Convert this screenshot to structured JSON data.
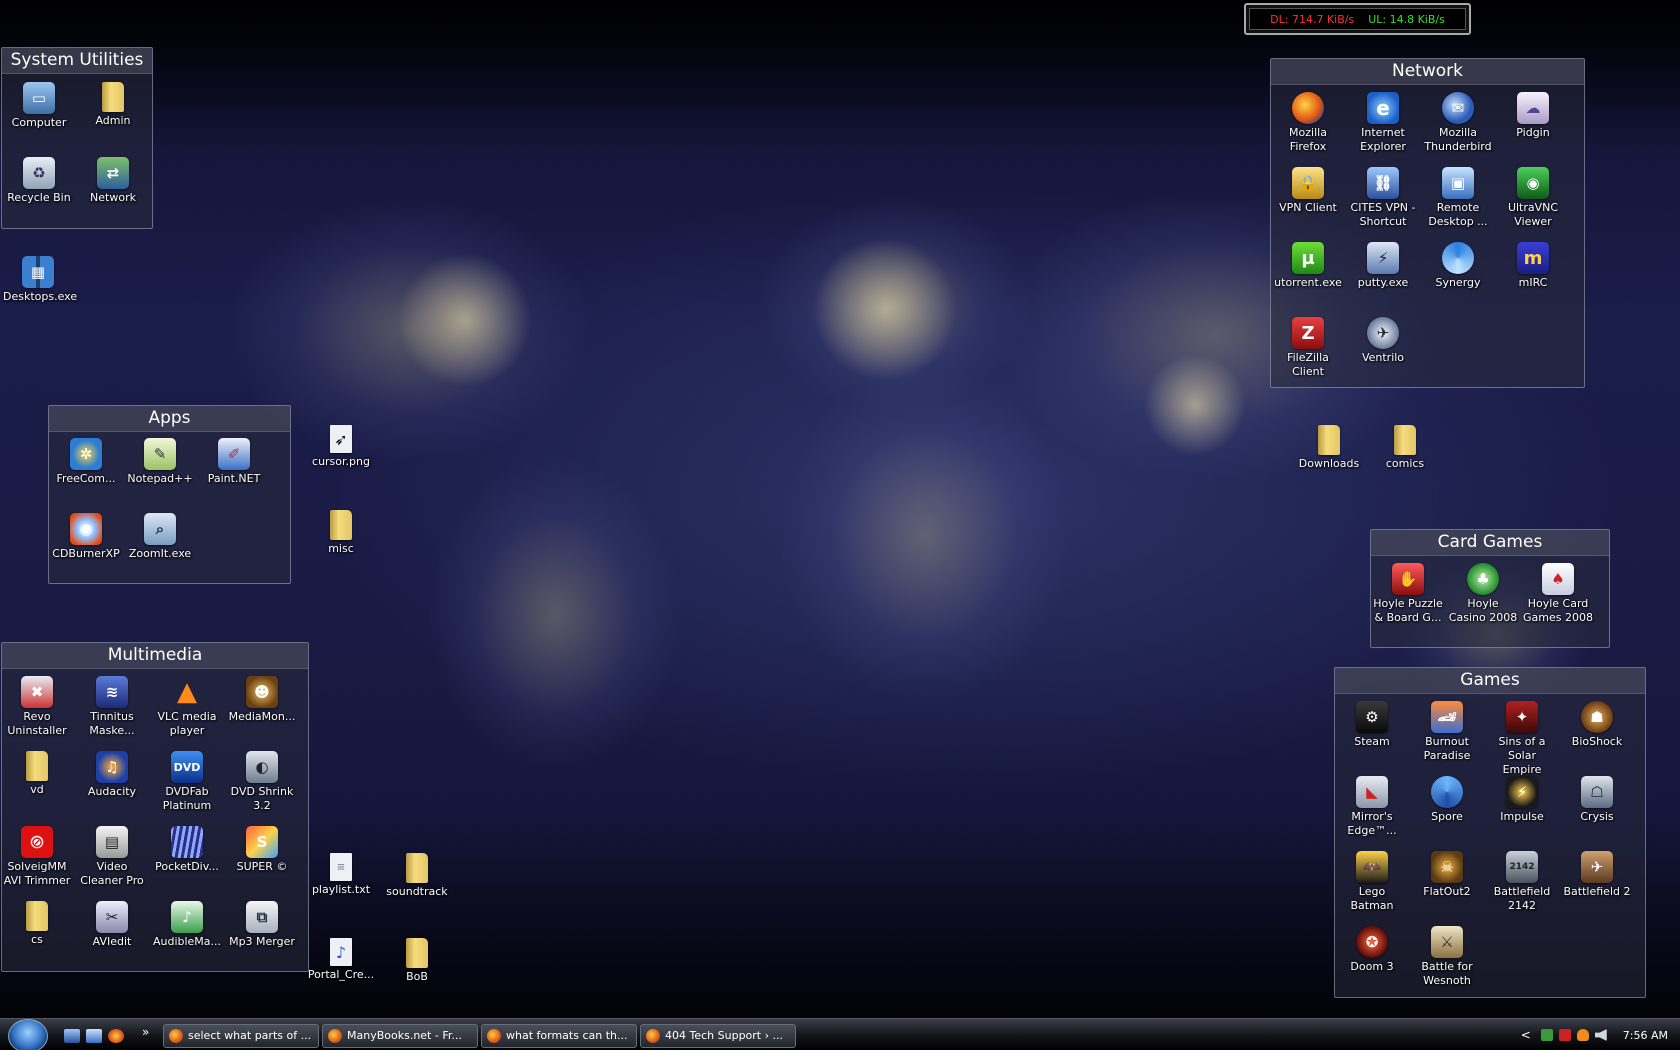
{
  "net_meter": {
    "dl": "DL: 714.7 KiB/s",
    "ul": "UL: 14.8 KiB/s"
  },
  "fences": {
    "system_utilities": {
      "title": "System Utilities",
      "items": [
        "Computer",
        "Admin",
        "Recycle Bin",
        "Network"
      ]
    },
    "network": {
      "title": "Network",
      "items": [
        "Mozilla Firefox",
        "Internet Explorer",
        "Mozilla Thunderbird",
        "Pidgin",
        "VPN Client",
        "CITES VPN - Shortcut",
        "Remote Desktop ...",
        "UltraVNC Viewer",
        "utorrent.exe",
        "putty.exe",
        "Synergy",
        "mIRC",
        "FileZilla Client",
        "Ventrilo"
      ]
    },
    "apps": {
      "title": "Apps",
      "items": [
        "FreeCom...",
        "Notepad++",
        "Paint.NET",
        "CDBurnerXP",
        "ZoomIt.exe"
      ]
    },
    "card_games": {
      "title": "Card Games",
      "items": [
        "Hoyle Puzzle & Board G...",
        "Hoyle Casino 2008",
        "Hoyle Card Games 2008"
      ]
    },
    "multimedia": {
      "title": "Multimedia",
      "items": [
        "Revo Uninstaller",
        "Tinnitus Maske...",
        "VLC media player",
        "MediaMon...",
        "vd",
        "Audacity",
        "DVDFab Platinum",
        "DVD Shrink 3.2",
        "SolveigMM AVI Trimmer",
        "Video Cleaner Pro",
        "PocketDiv...",
        "SUPER ©",
        "cs",
        "AVIedit",
        "AudibleMa...",
        "Mp3 Merger"
      ]
    },
    "games": {
      "title": "Games",
      "items": [
        "Steam",
        "Burnout Paradise",
        "Sins of a Solar Empire",
        "BioShock",
        "Mirror's Edge™...",
        "Spore",
        "Impulse",
        "Crysis",
        "Lego Batman",
        "FlatOut2",
        "Battlefield 2142",
        "Battlefield 2",
        "Doom 3",
        "Battle for Wesnoth"
      ]
    }
  },
  "desktop_icons": [
    "Desktops.exe",
    "cursor.png",
    "misc",
    "Downloads",
    "comics",
    "playlist.txt",
    "soundtrack",
    "Portal_Cre...",
    "BoB"
  ],
  "taskbar": {
    "quick_launch_more": "»",
    "tasks": [
      "select what parts of ...",
      "ManyBooks.net - Fr...",
      "what formats can th...",
      "404 Tech Support › ..."
    ],
    "tray_chevron": "<",
    "clock": "7:56 AM"
  },
  "colors": {
    "dl": "#ff3030",
    "ul": "#30e030",
    "fence_bg": "rgba(40,42,60,0.55)"
  }
}
